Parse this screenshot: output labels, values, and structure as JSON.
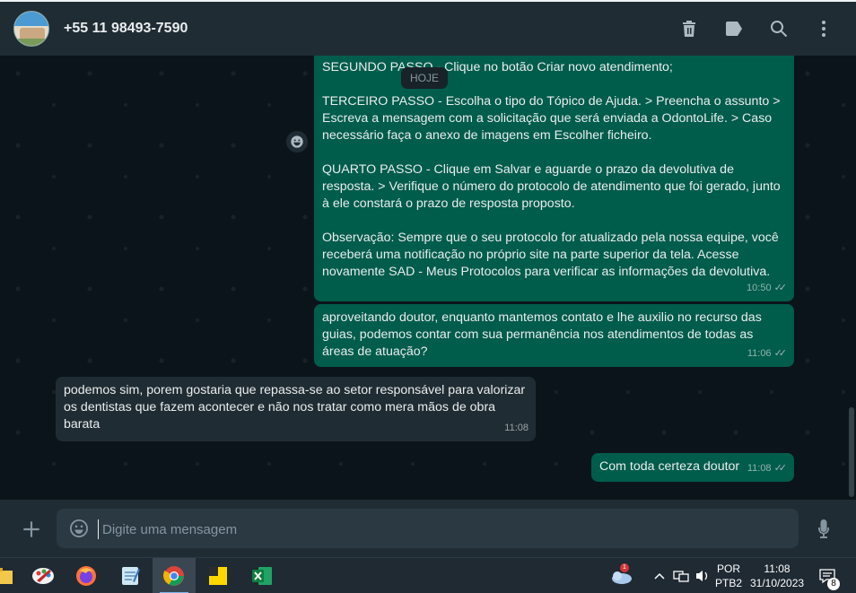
{
  "header": {
    "contact_name": "+55 11 98493-7590",
    "icons": [
      "delete-icon",
      "label-icon",
      "search-icon",
      "menu-icon"
    ]
  },
  "chat": {
    "date_chip": "HOJE",
    "messages": [
      {
        "direction": "outgoing",
        "text": "SEGUNDO PASSO - Clique no botão Criar novo atendimento;\n\nTERCEIRO PASSO - Escolha o tipo do Tópico de Ajuda. > Preencha o assunto > Escreva a mensagem com a solicitação que será enviada a OdontoLife. > Caso necessário faça o anexo de imagens em Escolher ficheiro.\n\nQUARTO PASSO - Clique em Salvar e aguarde o prazo da devolutiva de resposta. > Verifique o número do protocolo de atendimento que foi gerado, junto à ele constará o prazo de resposta proposto.\n\nObservação: Sempre que o seu protocolo for atualizado pela nossa equipe, você receberá uma notificação no próprio site na parte superior da tela. Acesse novamente SAD - Meus Protocolos para verificar as informações da devolutiva.",
        "time": "10:50",
        "read": true
      },
      {
        "direction": "outgoing",
        "text": "aproveitando doutor, enquanto mantemos contato e lhe auxilio no recurso das guias, podemos contar com sua permanência nos atendimentos de todas as áreas de atuação?",
        "time": "11:06",
        "read": true
      },
      {
        "direction": "incoming",
        "text": "podemos sim, porem gostaria que repassa-se ao setor responsável para valorizar os dentistas que fazem acontecer e não nos tratar como mera mãos de obra barata",
        "time": "11:08"
      },
      {
        "direction": "outgoing",
        "text": "Com toda certeza doutor",
        "time": "11:08",
        "read": true
      }
    ]
  },
  "composer": {
    "placeholder": "Digite uma mensagem"
  },
  "taskbar": {
    "apps": [
      "paint-icon",
      "firefox-icon",
      "notepad-icon",
      "chrome-icon",
      "sticky-notes-icon",
      "excel-icon"
    ],
    "active_app": "chrome-icon",
    "weather_badge": "1",
    "language_line1": "POR",
    "language_line2": "PTB2",
    "time": "11:08",
    "date": "31/10/2023",
    "notification_count": "8"
  },
  "colors": {
    "outgoing_bubble": "#005c4b",
    "incoming_bubble": "#202c33",
    "header_bg": "#202c33",
    "chat_bg": "#0b141a"
  }
}
